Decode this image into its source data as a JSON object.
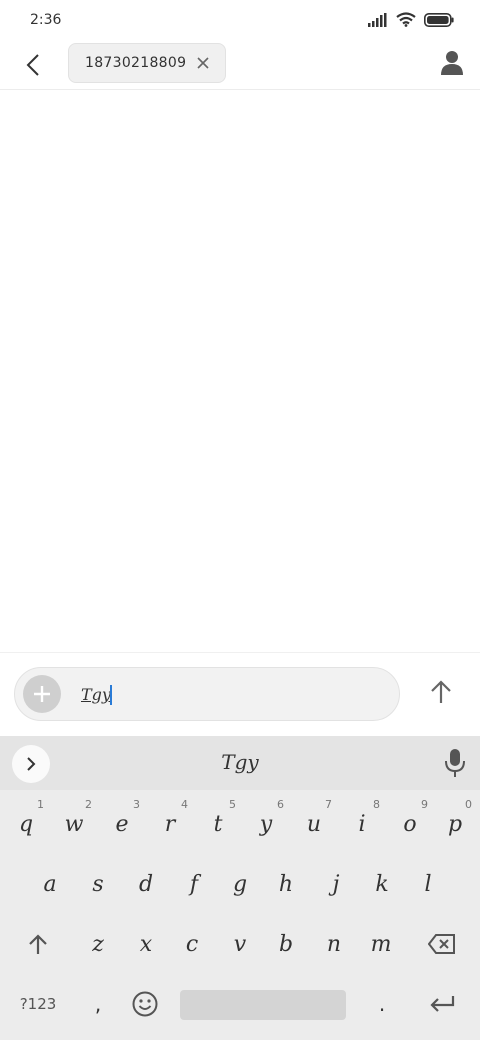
{
  "status": {
    "time": "2:36"
  },
  "header": {
    "recipient": "18730218809"
  },
  "compose": {
    "text": "Tgy"
  },
  "keyboard": {
    "suggestion": "Tgy",
    "row1": [
      {
        "k": "q",
        "h": "1"
      },
      {
        "k": "w",
        "h": "2"
      },
      {
        "k": "e",
        "h": "3"
      },
      {
        "k": "r",
        "h": "4"
      },
      {
        "k": "t",
        "h": "5"
      },
      {
        "k": "y",
        "h": "6"
      },
      {
        "k": "u",
        "h": "7"
      },
      {
        "k": "i",
        "h": "8"
      },
      {
        "k": "o",
        "h": "9"
      },
      {
        "k": "p",
        "h": "0"
      }
    ],
    "row2": [
      "a",
      "s",
      "d",
      "f",
      "g",
      "h",
      "j",
      "k",
      "l"
    ],
    "row3": [
      "z",
      "x",
      "c",
      "v",
      "b",
      "n",
      "m"
    ],
    "row4": {
      "symbols": "?123",
      "comma": ",",
      "period": "."
    }
  }
}
